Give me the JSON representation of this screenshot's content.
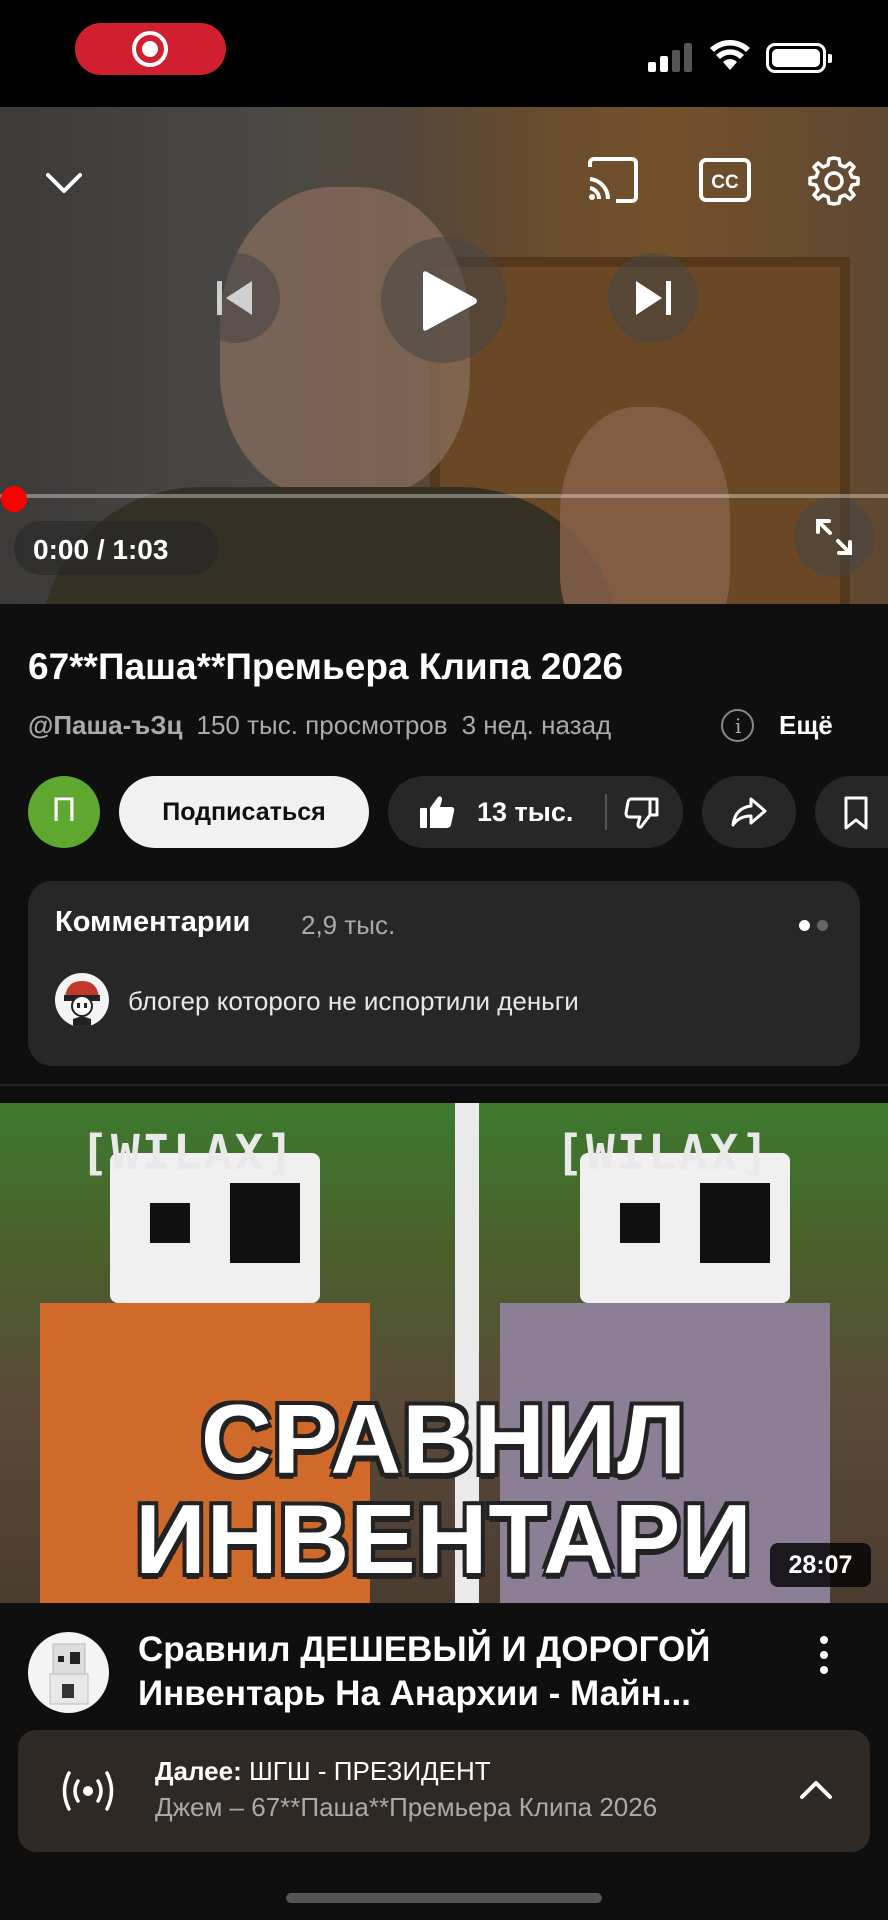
{
  "status_bar": {
    "recording_indicator": "record-icon",
    "signal_icon": "cellular-signal-icon",
    "wifi_icon": "wifi-icon",
    "battery_icon": "battery-icon"
  },
  "player": {
    "time": "0:00 / 1:03",
    "progress_fraction": 0,
    "icons": [
      "collapse-icon",
      "cast-icon",
      "captions-icon",
      "settings-icon",
      "previous-icon",
      "play-icon",
      "next-icon",
      "fullscreen-icon"
    ]
  },
  "video": {
    "title": "67**Паша**Премьера Клипа 2026",
    "channel": "@Паша-ъЗц",
    "views": "150 тыс. просмотров",
    "age": "3 нед. назад",
    "more_label": "Ещё"
  },
  "actions": {
    "channel_avatar_letter": "П",
    "subscribe_label": "Подписаться",
    "like_count": "13 тыс."
  },
  "comments": {
    "heading": "Комментарии",
    "count": "2,9 тыс.",
    "top_comment": "блогер которого не испортили деньги"
  },
  "next_video": {
    "thumbnail_tag_left": "[WILAX]",
    "thumbnail_tag_right": "[WILAX]",
    "thumbnail_line1": "СРАВНИЛ",
    "thumbnail_line2": "ИНВЕНТАРИ",
    "duration": "28:07",
    "title_line1": "Сравнил ДЕШЕВЫЙ И ДОРОГОЙ",
    "title_line2": "Инвентарь На Анархии - Майн..."
  },
  "up_next_bar": {
    "label": "Далее:",
    "next_title": "ШГШ - ПРЕЗИДЕНТ",
    "subtitle": "Джем – 67**Паша**Премьера Клипа 2026"
  },
  "colors": {
    "background": "#0f0f0f",
    "accent_red": "#ff0000",
    "pill_bg": "#272727",
    "channel_avatar": "#5ea831"
  }
}
